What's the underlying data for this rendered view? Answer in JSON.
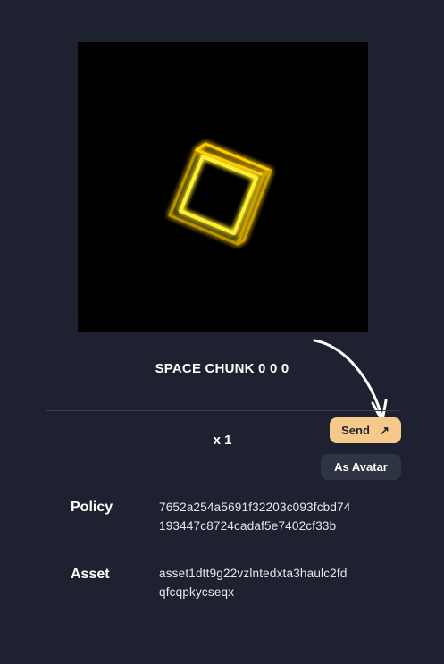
{
  "nft": {
    "image_icon": "glowing-yellow-cube-icon",
    "name": "SPACE CHUNK 0 0 0"
  },
  "quantity": "x 1",
  "actions": {
    "send_label": "Send",
    "send_icon": "↗",
    "avatar_label": "As Avatar"
  },
  "details": {
    "policy_label": "Policy",
    "policy_line1": "7652a254a5691f32203c093fcbd74",
    "policy_line2": "193447c8724cadaf5e7402cf33b",
    "asset_label": "Asset",
    "asset_line1": "asset1dtt9g22vzlntedxta3haulc2fd",
    "asset_line2": "qfcqpkycseqx"
  },
  "colors": {
    "background": "#1e2230",
    "send_button": "#f5c98a",
    "avatar_button": "#2f3443",
    "cube_glow": "#ffe600"
  }
}
